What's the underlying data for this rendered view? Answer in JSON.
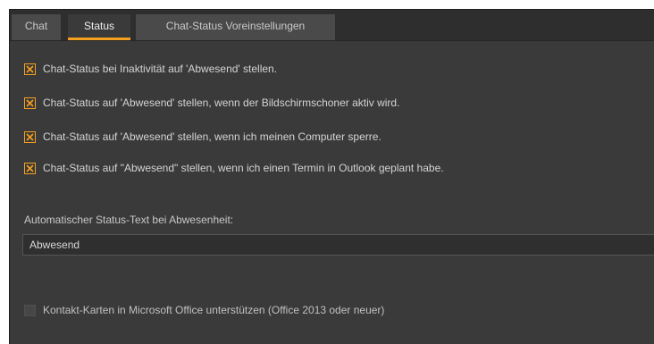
{
  "tabs": [
    {
      "label": "Chat",
      "active": false
    },
    {
      "label": "Status",
      "active": true
    },
    {
      "label": "Chat-Status Voreinstellungen",
      "active": false
    }
  ],
  "accent_color": "#f5a020",
  "options": [
    {
      "label": "Chat-Status bei Inaktivität auf 'Abwesend' stellen.",
      "checked": true
    },
    {
      "label": "Chat-Status auf 'Abwesend' stellen, wenn der Bildschirmschoner aktiv wird.",
      "checked": true
    },
    {
      "label": "Chat-Status auf 'Abwesend' stellen, wenn ich meinen Computer sperre.",
      "checked": true
    },
    {
      "label": "Chat-Status auf \"Abwesend\" stellen, wenn ich einen Termin in Outlook geplant habe.",
      "checked": true
    }
  ],
  "away_text": {
    "label": "Automatischer Status-Text bei Abwesenheit:",
    "value": "Abwesend"
  },
  "contact_cards": {
    "label": "Kontakt-Karten in Microsoft Office unterstützen (Office 2013 oder neuer)",
    "checked": false
  }
}
